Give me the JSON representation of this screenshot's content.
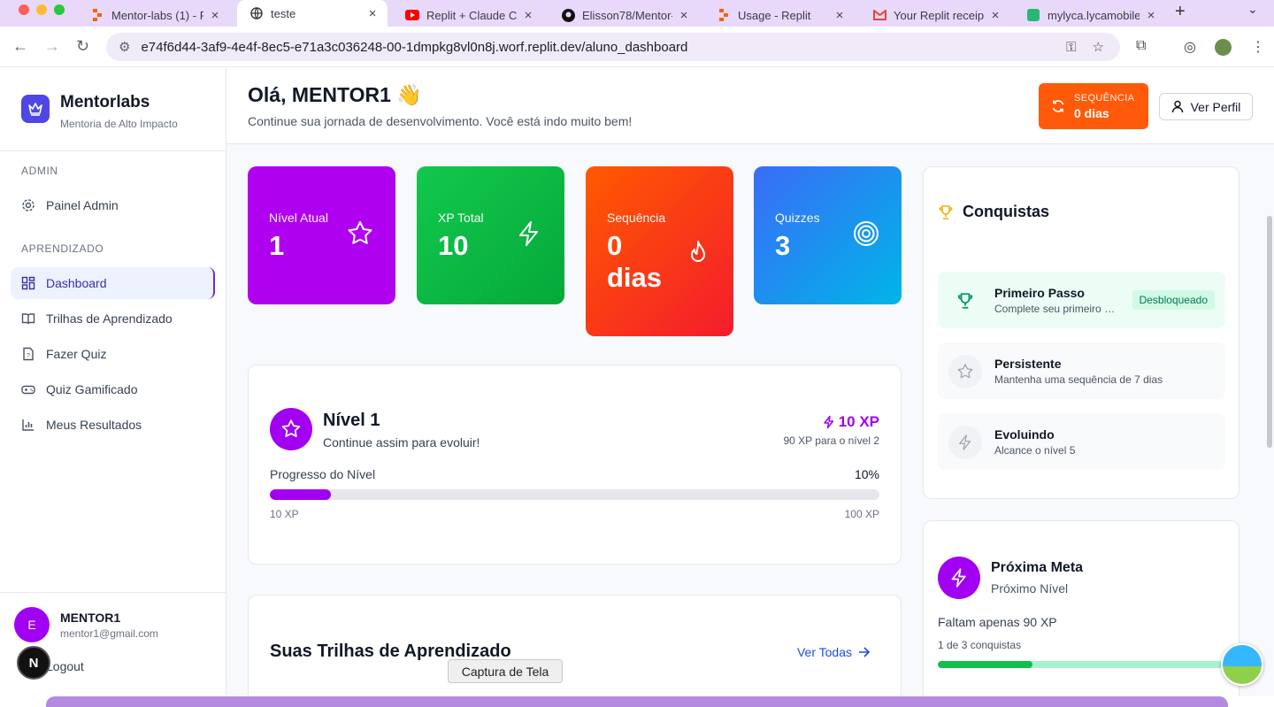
{
  "browser": {
    "tabs": [
      {
        "title": "Mentor-labs (1) - R",
        "icon": "replit-icon"
      },
      {
        "title": "teste",
        "icon": "globe-icon",
        "active": true
      },
      {
        "title": "Replit + Claude Co",
        "icon": "youtube-icon"
      },
      {
        "title": "Elisson78/Mentor-",
        "icon": "github-icon"
      },
      {
        "title": "Usage - Replit",
        "icon": "replit-icon"
      },
      {
        "title": "Your Replit receipt",
        "icon": "gmail-icon"
      },
      {
        "title": "mylyca.lycamobile",
        "icon": "lyca-icon"
      }
    ],
    "url": "e74f6d44-3af9-4e4f-8ec5-e71a3c036248-00-1dmpkg8vl0n8j.worf.replit.dev/aluno_dashboard"
  },
  "sidebar": {
    "brand_name": "Mentorlabs",
    "brand_sub": "Mentoria de Alto Impacto",
    "section_admin": "ADMIN",
    "admin_item": "Painel Admin",
    "section_learning": "APRENDIZADO",
    "items": [
      {
        "label": "Dashboard"
      },
      {
        "label": "Trilhas de Aprendizado"
      },
      {
        "label": "Fazer Quiz"
      },
      {
        "label": "Quiz Gamificado"
      },
      {
        "label": "Meus Resultados"
      }
    ],
    "user": {
      "initial": "E",
      "name": "MENTOR1",
      "email": "mentor1@gmail.com",
      "logout": "Logout"
    },
    "n_badge": "N"
  },
  "header": {
    "greeting": "Olá, MENTOR1 👋",
    "subtitle": "Continue sua jornada de desenvolvimento. Você está indo muito bem!",
    "streak_label": "SEQUÊNCIA",
    "streak_value": "0 dias",
    "profile_button": "Ver Perfil"
  },
  "stats": [
    {
      "label": "Nível Atual",
      "value": "1",
      "icon": "star-icon",
      "color": "#b000f0"
    },
    {
      "label": "XP Total",
      "value": "10",
      "icon": "lightning-icon",
      "color": "#0ec24a"
    },
    {
      "label": "Sequência",
      "value_line1": "0",
      "value_line2": "dias",
      "icon": "flame-icon",
      "color": "#ff4a00"
    },
    {
      "label": "Quizzes",
      "value": "3",
      "icon": "target-icon",
      "color": "#1591f5"
    }
  ],
  "level_card": {
    "title": "Nível 1",
    "subtitle": "Continue assim para evoluir!",
    "xp": "10 XP",
    "next": "90 XP para o nível 2",
    "progress_label": "Progresso do Nível",
    "progress_percent": "10%",
    "progress_fraction": 0.1,
    "min_label": "10 XP",
    "max_label": "100 XP"
  },
  "trails": {
    "title": "Suas Trilhas de Aprendizado",
    "view_all": "Ver Todas"
  },
  "achievements": {
    "title": "Conquistas",
    "items": [
      {
        "title": "Primeiro Passo",
        "desc": "Complete seu primeiro quiz",
        "badge": "Desbloqueado",
        "unlocked": true
      },
      {
        "title": "Persistente",
        "desc": "Mantenha uma sequência de 7 dias",
        "unlocked": false
      },
      {
        "title": "Evoluindo",
        "desc": "Alcance o nível 5",
        "unlocked": false
      }
    ]
  },
  "next_goal": {
    "title": "Próxima Meta",
    "subtitle": "Próximo Nível",
    "remaining": "Faltam apenas 90 XP",
    "conquests": "1 de 3 conquistas",
    "progress_fraction": 0.33
  },
  "tooltip": "Captura de Tela",
  "colors": {
    "accent_purple": "#a100f2",
    "indigo": "#4f46e5",
    "orange": "#ff5a0a",
    "green": "#10b981"
  }
}
